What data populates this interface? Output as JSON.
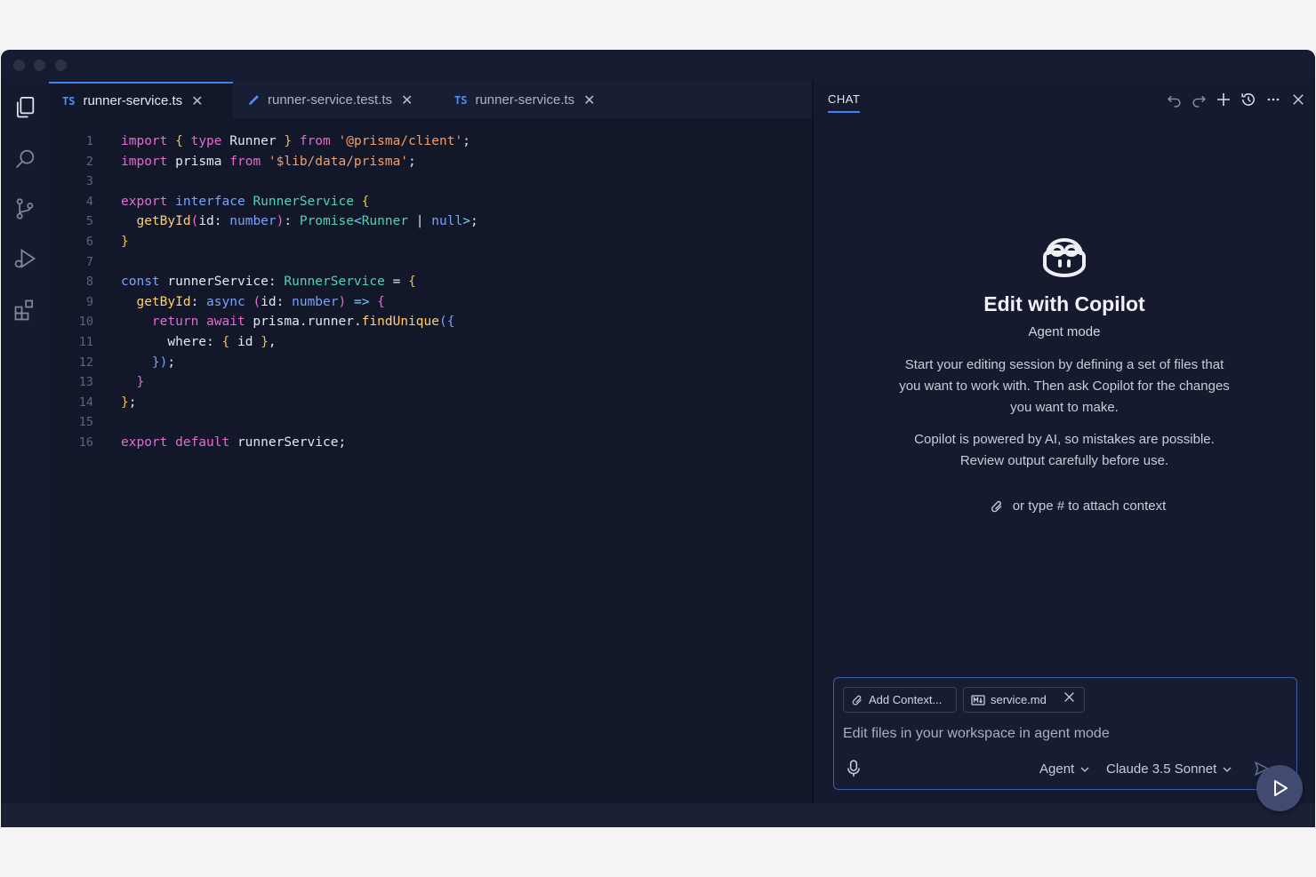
{
  "editor": {
    "tabs": [
      {
        "badge": "TS",
        "label": "runner-service.ts",
        "active": true
      },
      {
        "badge": "",
        "label": "runner-service.test.ts",
        "active": false
      },
      {
        "badge": "TS",
        "label": "runner-service.ts",
        "active": false
      }
    ],
    "close_glyph": "✕",
    "line_numbers": [
      "1",
      "2",
      "3",
      "4",
      "5",
      "6",
      "7",
      "8",
      "9",
      "10",
      "11",
      "12",
      "13",
      "14",
      "15",
      "16"
    ]
  },
  "chat": {
    "title": "CHAT",
    "welcome": {
      "title": "Edit with Copilot",
      "subtitle": "Agent mode",
      "description": "Start your editing session by defining a set of files that you want to work with. Then ask Copilot for the changes you want to make.",
      "disclaimer": "Copilot is powered by AI, so mistakes are possible. Review output carefully before use.",
      "attach_hint": "or type # to attach context"
    },
    "input": {
      "add_context_label": "Add Context...",
      "file_chip_label": "service.md",
      "placeholder": "Edit files in your workspace in agent mode",
      "mode_label": "Agent",
      "model_label": "Claude 3.5 Sonnet"
    }
  },
  "colors": {
    "accent": "#3b82f6",
    "background": "#12172a",
    "keyword": "#e66ad3",
    "string": "#f29f6b",
    "type": "#54d3b3"
  }
}
